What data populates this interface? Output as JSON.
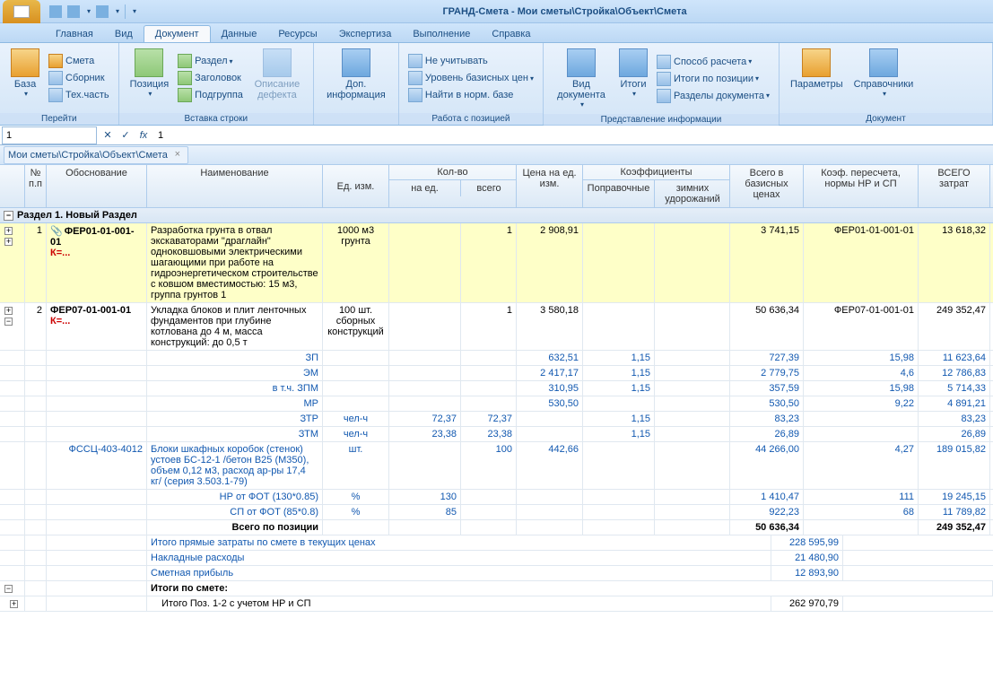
{
  "title": "ГРАНД-Смета - Мои сметы\\Стройка\\Объект\\Смета",
  "tabs": [
    "Главная",
    "Вид",
    "Документ",
    "Данные",
    "Ресурсы",
    "Экспертиза",
    "Выполнение",
    "Справка"
  ],
  "active_tab": 2,
  "ribbon": {
    "g1": {
      "title": "Перейти",
      "big": "База",
      "items": [
        "Смета",
        "Сборник",
        "Тех.часть"
      ]
    },
    "g2": {
      "title": "Вставка строки",
      "big": "Позиция",
      "col1": [
        "Раздел",
        "Заголовок",
        "Подгруппа"
      ],
      "defect": "Описание дефекта"
    },
    "g3": {
      "title": "",
      "big": "Доп. информация"
    },
    "g4": {
      "title": "Работа с позицией",
      "items": [
        "Не учитывать",
        "Уровень базисных цен",
        "Найти в норм. базе"
      ]
    },
    "g5": {
      "title": "Представление информации",
      "big1": "Вид документа",
      "big2": "Итоги",
      "items": [
        "Способ расчета",
        "Итоги по позиции",
        "Разделы документа"
      ]
    },
    "g6": {
      "title": "Документ",
      "big1": "Параметры",
      "big2": "Справочники"
    }
  },
  "formula": {
    "cellref": "1",
    "value": "1"
  },
  "breadcrumb": "Мои сметы\\Стройка\\Объект\\Смета",
  "headers": {
    "num": "№ п.п",
    "osn": "Обоснование",
    "name": "Наименование",
    "unit": "Ед. изм.",
    "qty": "Кол-во",
    "qed": "на ед.",
    "qall": "всего",
    "price": "Цена на ед. изм.",
    "koef": "Коэффициенты",
    "kpop": "Поправочные",
    "kzim": "зимних удорожаний",
    "base": "Всего в базисных ценах",
    "kper": "Коэф. пересчета, нормы НР и СП",
    "total": "ВСЕГО затрат"
  },
  "section": "Раздел 1. Новый Раздел",
  "rows": [
    {
      "n": "1",
      "osn": "ФЕР01-01-001-01",
      "koz": "К=...",
      "name": "Разработка грунта в отвал экскаваторами \"драглайн\" одноковшовыми электрическими шагающими при работе на гидроэнергетическом строительстве с ковшом вместимостью: 15 м3, группа грунтов 1",
      "unit": "1000 м3 грунта",
      "qall": "1",
      "price": "2 908,91",
      "base": "3 741,15",
      "kper": "ФЕР01-01-001-01",
      "total": "13 618,32",
      "hl": true,
      "att": true
    },
    {
      "n": "2",
      "osn": "ФЕР07-01-001-01",
      "koz": "К=...",
      "name": "Укладка блоков и плит ленточных фундаментов при глубине котлована до 4 м, масса конструкций: до 0,5 т",
      "unit": "100 шт. сборных конструкций",
      "qall": "1",
      "price": "3 580,18",
      "base": "50 636,34",
      "kper": "ФЕР07-01-001-01",
      "total": "249 352,47"
    }
  ],
  "sub": [
    {
      "name": "ЗП",
      "price": "632,51",
      "kpop": "1,15",
      "base": "727,39",
      "kper": "15,98",
      "total": "11 623,64"
    },
    {
      "name": "ЭМ",
      "price": "2 417,17",
      "kpop": "1,15",
      "base": "2 779,75",
      "kper": "4,6",
      "total": "12 786,83"
    },
    {
      "name": "в т.ч. ЗПМ",
      "price": "310,95",
      "kpop": "1,15",
      "base": "357,59",
      "kper": "15,98",
      "total": "5 714,33"
    },
    {
      "name": "МР",
      "price": "530,50",
      "base": "530,50",
      "kper": "9,22",
      "total": "4 891,21"
    },
    {
      "name": "ЗТР",
      "unit": "чел-ч",
      "qed": "72,37",
      "qall": "72,37",
      "kpop": "1,15",
      "base": "83,23",
      "total": "83,23"
    },
    {
      "name": "ЗТМ",
      "unit": "чел-ч",
      "qed": "23,38",
      "qall": "23,38",
      "kpop": "1,15",
      "base": "26,89",
      "total": "26,89"
    }
  ],
  "res": {
    "osn": "ФССЦ-403-4012",
    "name": "Блоки шкафных коробок (стенок) устоев БС-12-1 /бетон В25 (М350), объем 0,12 м3, расход ар-ры 17,4 кг/ (серия 3.503.1-79)",
    "unit": "шт.",
    "qall": "100",
    "price": "442,66",
    "base": "44 266,00",
    "kper": "4,27",
    "total": "189 015,82"
  },
  "nr": {
    "name": "НР от ФОТ (130*0.85)",
    "unit": "%",
    "qed": "130",
    "base": "1 410,47",
    "kper": "111",
    "total": "19 245,15"
  },
  "sp": {
    "name": "СП от ФОТ (85*0.8)",
    "unit": "%",
    "qed": "85",
    "base": "922,23",
    "kper": "68",
    "total": "11 789,82"
  },
  "postotal": {
    "name": "Всего по позиции",
    "base": "50 636,34",
    "total": "249 352,47"
  },
  "summary": [
    {
      "name": "Итого прямые затраты по смете в текущих ценах",
      "total": "228 595,99"
    },
    {
      "name": "Накладные расходы",
      "total": "21 480,90"
    },
    {
      "name": "Сметная прибыль",
      "total": "12 893,90"
    }
  ],
  "itogi_header": "Итоги по смете:",
  "itogi_row": {
    "name": "Итого Поз. 1-2 с учетом НР и СП",
    "total": "262 970,79"
  }
}
